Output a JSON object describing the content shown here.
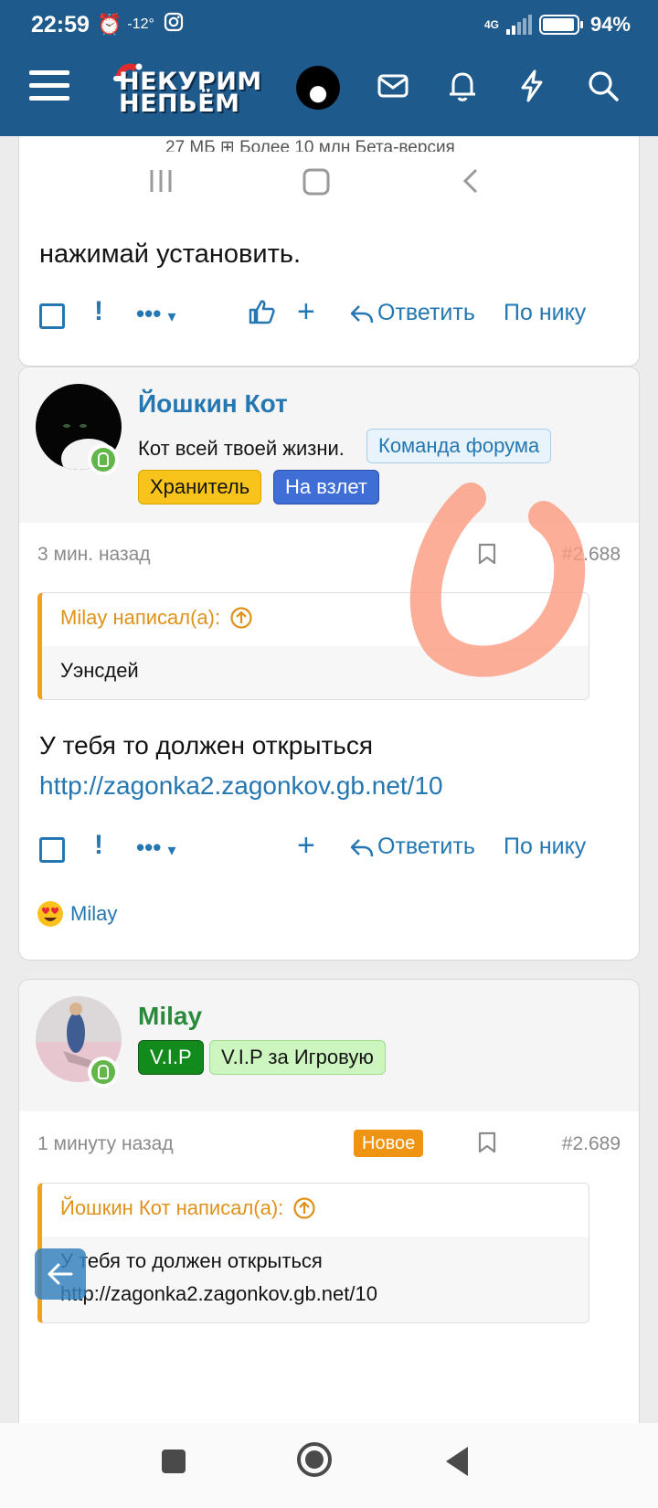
{
  "status_bar": {
    "time": "22:59",
    "temperature": "-12°",
    "network": "4G",
    "battery": "94%",
    "battery_level": 0.94
  },
  "header": {
    "logo_line1": "НЕКУРИМ",
    "logo_line2": "НЕПЬЁМ",
    "icons": [
      "menu-icon",
      "mail-icon",
      "bell-icon",
      "lightning-icon",
      "search-icon"
    ]
  },
  "posts": [
    {
      "partial_top_line": "27 МБ   ⊞ Более 10 млн   Бета-версия",
      "text": "нажимай установить.",
      "actions": {
        "more": "•••",
        "reply": "Ответить",
        "by_nick": "По нику"
      }
    },
    {
      "author": "Йошкин Кот",
      "user_title": "Кот всей твоей жизни.",
      "badges": [
        "Команда форума",
        "Хранитель",
        "На взлет"
      ],
      "time": "3 мин. назад",
      "post_number": "#2.688",
      "quote": {
        "header": "Milay написал(а):",
        "text": "Уэнсдей"
      },
      "body_line1": "У тебя то должен открыться",
      "body_link": "http://zagonka2.zagonkov.gb.net/10",
      "actions": {
        "more": "•••",
        "reply": "Ответить",
        "by_nick": "По нику"
      },
      "reaction_user": "Milay"
    },
    {
      "author": "Milay",
      "badges": [
        "V.I.P",
        "V.I.P за Игровую"
      ],
      "time": "1 минуту назад",
      "new_label": "Новое",
      "post_number": "#2.689",
      "quote": {
        "header": "Йошкин Кот написал(а):",
        "text": "У тебя то должен открыться",
        "link": "http://zagonka2.zagonkov.gb.net/10"
      }
    }
  ],
  "colors": {
    "header_bg": "#1f5a8c",
    "link": "#2577b1",
    "quote_accent": "#f0a21d",
    "badge_keeper": "#f8c41c",
    "badge_takeoff": "#3f6fd6",
    "badge_vip": "#128a1c",
    "new_badge": "#ef9313",
    "online": "#63b74a"
  }
}
